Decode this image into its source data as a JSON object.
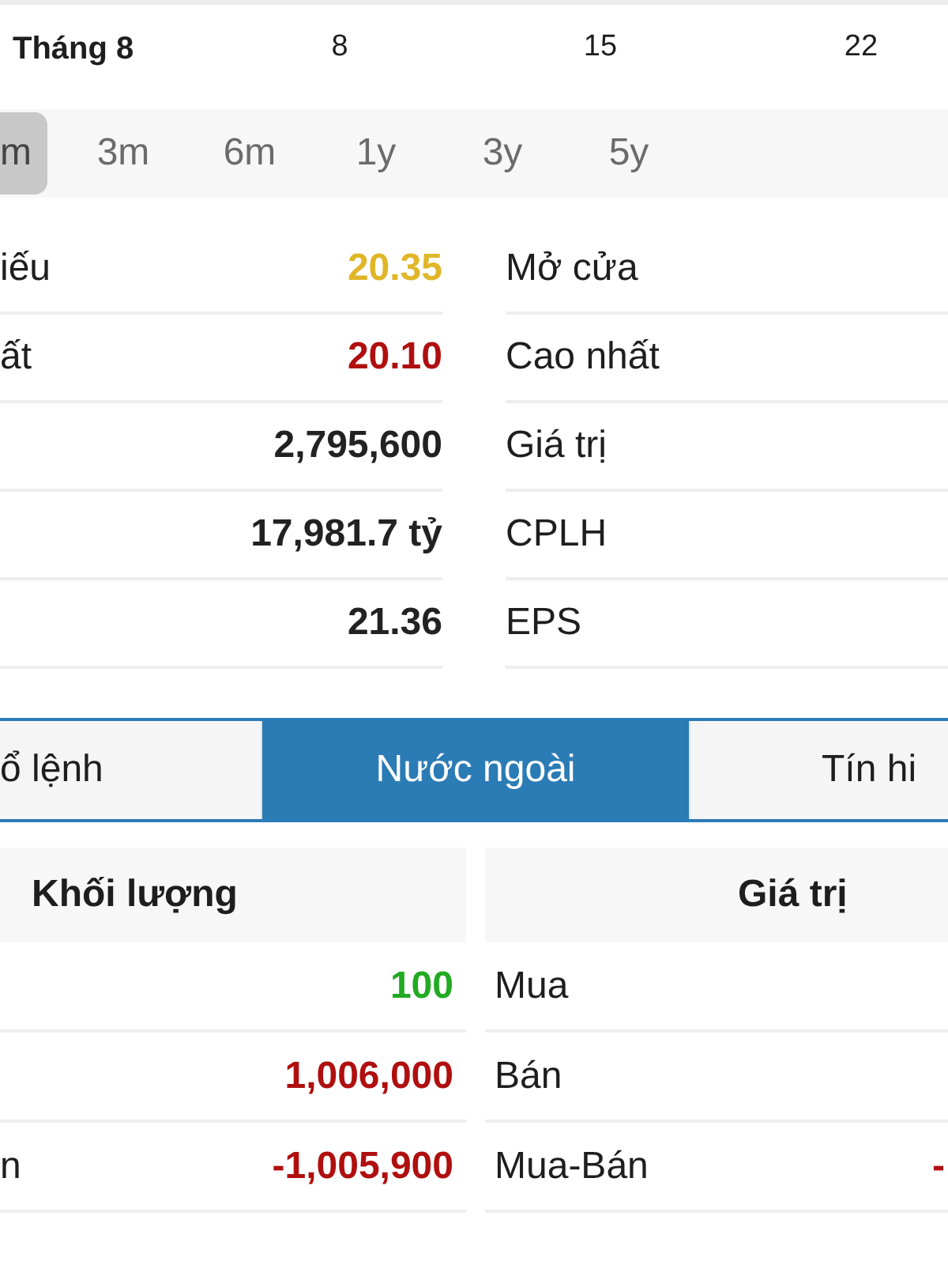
{
  "chart_axis": {
    "month_label": "Tháng 8",
    "day_labels": [
      "8",
      "15",
      "22"
    ]
  },
  "period_tabs": [
    {
      "label": "m",
      "selected": true
    },
    {
      "label": "3m",
      "selected": false
    },
    {
      "label": "6m",
      "selected": false
    },
    {
      "label": "1y",
      "selected": false
    },
    {
      "label": "3y",
      "selected": false
    },
    {
      "label": "5y",
      "selected": false
    }
  ],
  "stats_left": [
    {
      "label": "iếu",
      "value": "20.35",
      "color": "#e0b628"
    },
    {
      "label": "ất",
      "value": "20.10",
      "color": "#b00f0f"
    },
    {
      "value": "2,795,600",
      "color": "#222222"
    },
    {
      "value": "17,981.7 tỷ",
      "color": "#222222"
    },
    {
      "value": "21.36",
      "color": "#222222"
    }
  ],
  "stats_right": [
    {
      "label": "Mở cửa"
    },
    {
      "label": "Cao nhất"
    },
    {
      "label": "Giá trị"
    },
    {
      "label": "CPLH"
    },
    {
      "label": "EPS"
    }
  ],
  "detail_tabs": [
    {
      "label": "ổ lệnh",
      "selected": false
    },
    {
      "label": "Nước ngoài",
      "selected": true
    },
    {
      "label": "Tín hi",
      "selected": false
    }
  ],
  "foreign_volume": {
    "header": "Khối lượng",
    "rows": [
      {
        "value": "100",
        "color": "#22aa22"
      },
      {
        "value": "1,006,000",
        "color": "#b00f0f"
      },
      {
        "label": "n",
        "value": "-1,005,900",
        "color": "#b00f0f"
      }
    ]
  },
  "foreign_value": {
    "header": "Giá trị",
    "rows": [
      {
        "label": "Mua"
      },
      {
        "label": "Bán"
      },
      {
        "label": "Mua-Bán",
        "value": "-",
        "color": "#b00f0f"
      }
    ]
  }
}
